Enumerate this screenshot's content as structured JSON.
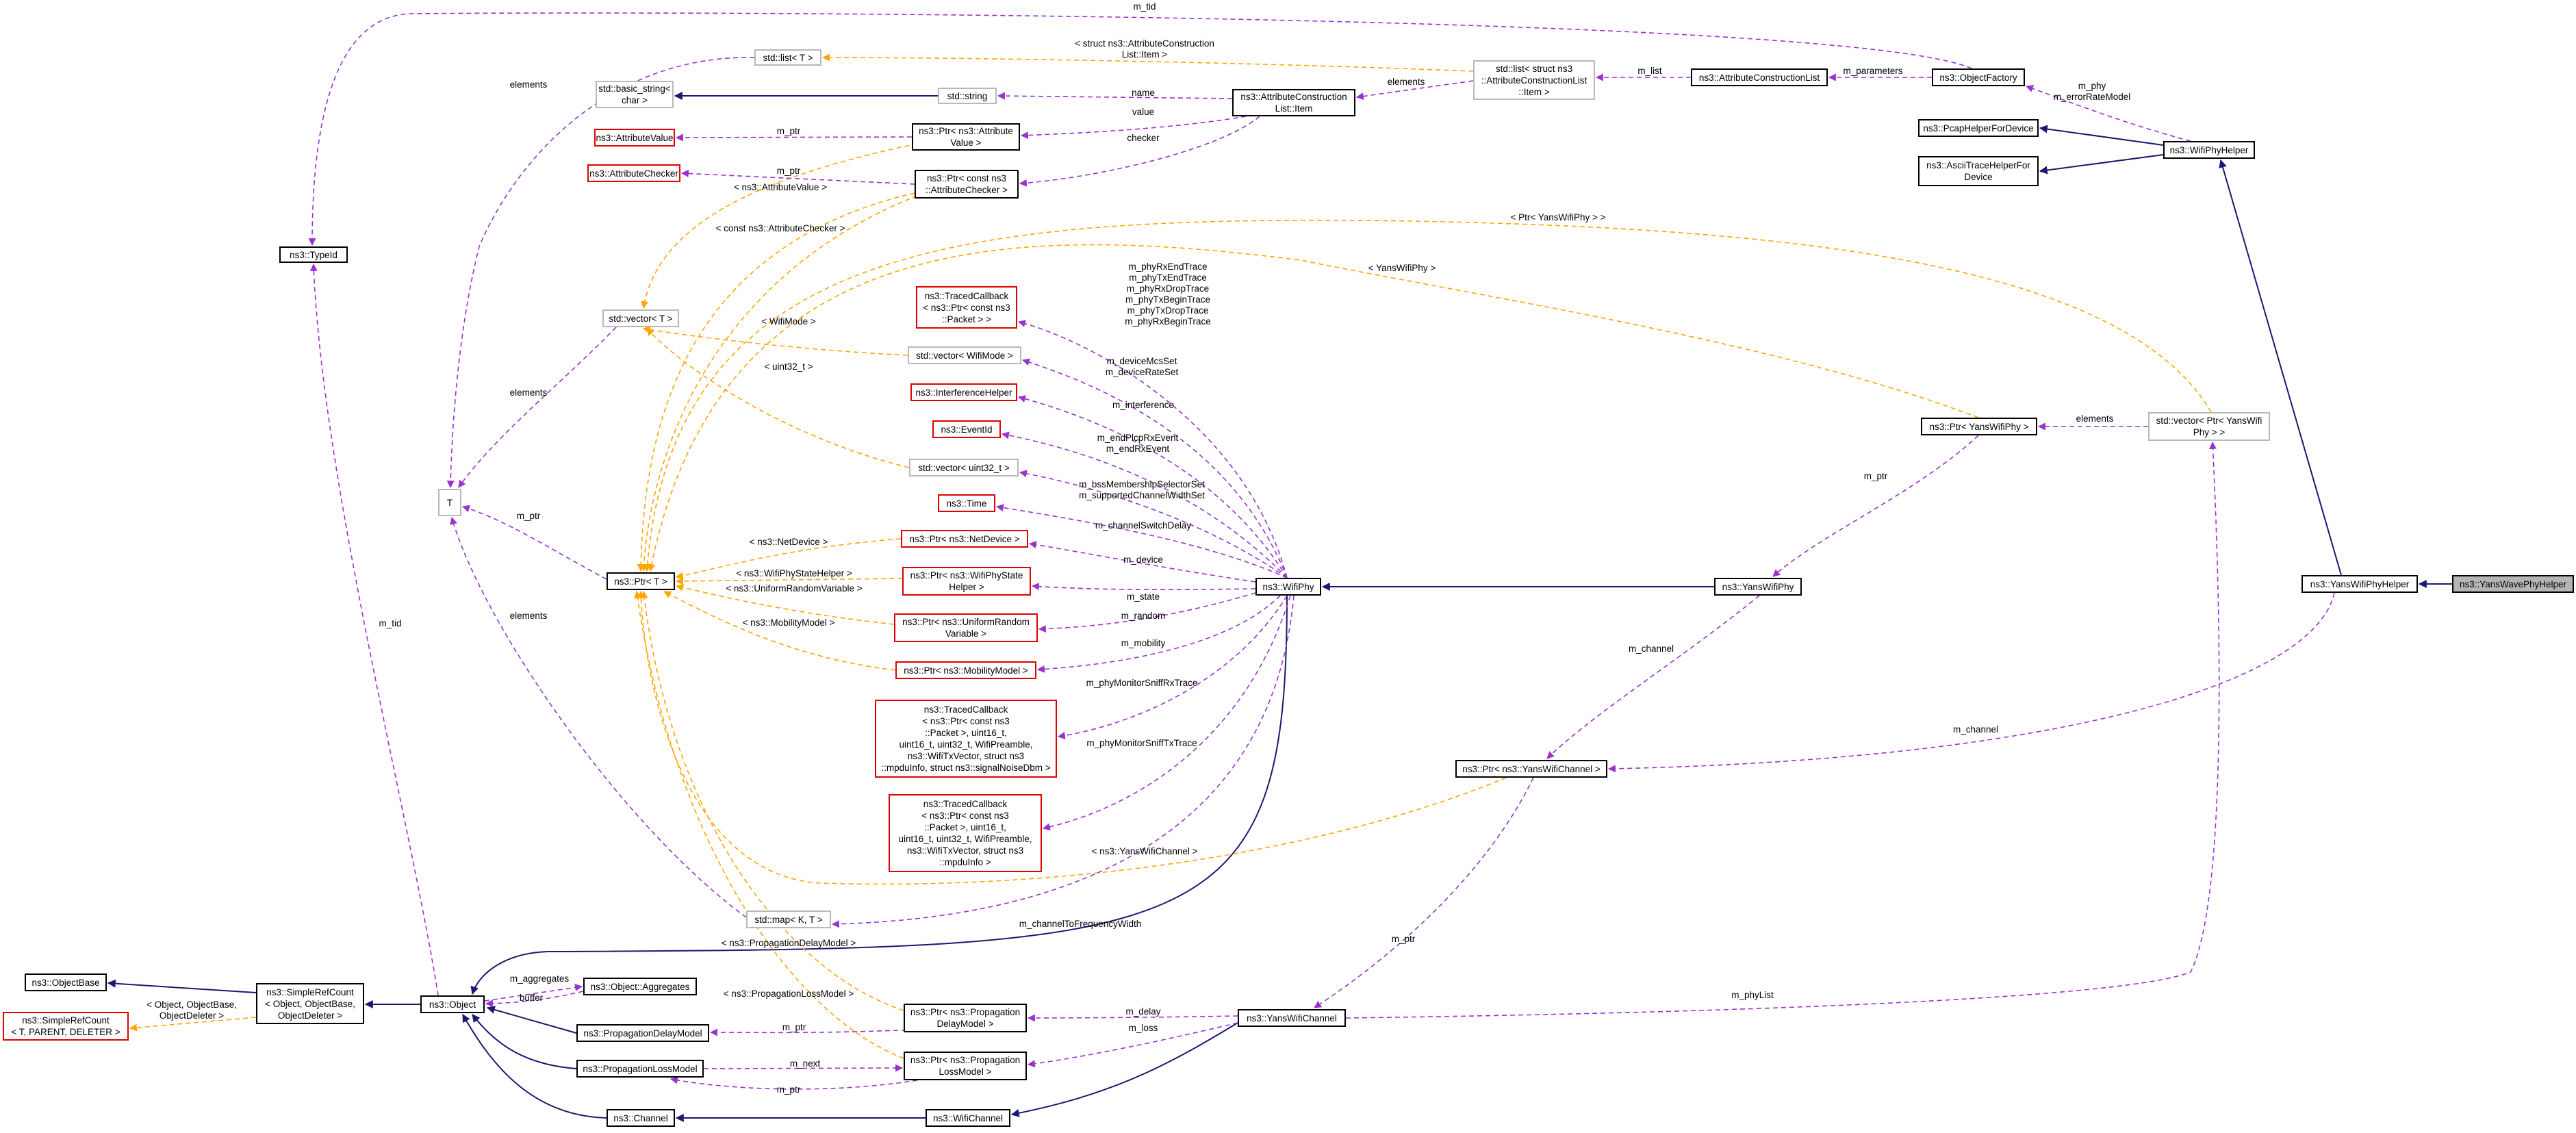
{
  "diagram": {
    "nodes": {
      "typeid": "ns3::TypeId",
      "list_t": "std::list< T >",
      "basic_string": "std::basic_string<\nchar >",
      "std_string": "std::string",
      "attribute_value": "ns3::AttributeValue",
      "attribute_checker": "ns3::AttributeChecker",
      "ptr_attr_value": "ns3::Ptr< ns3::Attribute\nValue >",
      "ptr_attr_checker": "ns3::Ptr< const ns3\n::AttributeChecker >",
      "attr_construction_item": "ns3::AttributeConstruction\nList::Item",
      "std_list_item": "std::list< struct ns3\n::AttributeConstructionList\n::Item >",
      "attr_construction_list": "ns3::AttributeConstructionList",
      "object_factory": "ns3::ObjectFactory",
      "pcap_helper": "ns3::PcapHelperForDevice",
      "ascii_helper": "ns3::AsciiTraceHelperFor\nDevice",
      "wifi_phy_helper": "ns3::WifiPhyHelper",
      "std_vector_t": "std::vector< T >",
      "traced_cb_packet": "ns3::TracedCallback\n< ns3::Ptr< const ns3\n::Packet > >",
      "vector_wifimode": "std::vector< WifiMode >",
      "interference_helper": "ns3::InterferenceHelper",
      "event_id": "ns3::EventId",
      "vector_uint32": "std::vector< uint32_t >",
      "time": "ns3::Time",
      "t": "T",
      "ptr_t": "ns3::Ptr< T >",
      "ptr_netdevice": "ns3::Ptr< ns3::NetDevice >",
      "ptr_wifiphy_state": "ns3::Ptr< ns3::WifiPhyState\nHelper >",
      "ptr_uniform_random": "ns3::Ptr< ns3::UniformRandom\nVariable >",
      "ptr_mobility": "ns3::Ptr< ns3::MobilityModel >",
      "traced_cb_monitor_rx": "ns3::TracedCallback\n< ns3::Ptr< const ns3\n::Packet >, uint16_t,\nuint16_t, uint32_t, WifiPreamble,\nns3::WifiTxVector, struct ns3\n::mpduInfo, struct ns3::signalNoiseDbm >",
      "traced_cb_monitor_tx": "ns3::TracedCallback\n< ns3::Ptr< const ns3\n::Packet >, uint16_t,\nuint16_t, uint32_t, WifiPreamble,\nns3::WifiTxVector, struct ns3\n::mpduInfo >",
      "wifi_phy": "ns3::WifiPhy",
      "ptr_yans_wifi_phy": "ns3::Ptr< YansWifiPhy >",
      "vector_ptr_yans": "std::vector< Ptr< YansWifi\nPhy > >",
      "yans_wifi_phy": "ns3::YansWifiPhy",
      "yans_wifi_phy_helper": "ns3::YansWifiPhyHelper",
      "yans_wave_phy_helper": "ns3::YansWavePhyHelper",
      "ptr_yans_wifi_channel": "ns3::Ptr< ns3::YansWifiChannel >",
      "std_map": "std::map< K, T >",
      "object_base": "ns3::ObjectBase",
      "simple_ref_count": "ns3::SimpleRefCount\n< Object, ObjectBase,\nObjectDeleter >",
      "simple_ref_count_t": "ns3::SimpleRefCount\n< T, PARENT, DELETER >",
      "object": "ns3::Object",
      "object_aggregates": "ns3::Object::Aggregates",
      "propagation_delay_model": "ns3::PropagationDelayModel",
      "propagation_loss_model": "ns3::PropagationLossModel",
      "ptr_prop_delay": "ns3::Ptr< ns3::Propagation\nDelayModel >",
      "ptr_prop_loss": "ns3::Ptr< ns3::Propagation\nLossModel >",
      "yans_wifi_channel": "ns3::YansWifiChannel",
      "wifi_channel": "ns3::WifiChannel",
      "channel": "ns3::Channel"
    },
    "edge_labels": {
      "m_tid_top": "m_tid",
      "m_tid_left": "m_tid",
      "elements_list": "elements",
      "elements_vector": "elements",
      "elements_map": "elements",
      "elements_std_list": "elements",
      "elements_yans": "elements",
      "tmpl_attr_item": "< struct ns3::AttributeConstruction\nList::Item >",
      "name": "name",
      "value": "value",
      "checker": "checker",
      "m_list": "m_list",
      "m_parameters": "m_parameters",
      "m_phy": "m_phy\nm_errorRateModel",
      "m_ptr_av": "m_ptr",
      "m_ptr_ac": "m_ptr",
      "m_ptr_t": "m_ptr",
      "m_ptr_yans": "m_ptr",
      "m_ptr_channel": "m_ptr",
      "m_ptr_delay": "m_ptr",
      "m_ptr_loss": "m_ptr",
      "tmpl_attr_value": "< ns3::AttributeValue >",
      "tmpl_attr_checker": "< const ns3::AttributeChecker >",
      "tmpl_ptr_yans_vec": "< Ptr< YansWifiPhy > >",
      "tmpl_yans_phy": "< YansWifiPhy >",
      "tmpl_wifimode": "< WifiMode >",
      "tmpl_uint32": "< uint32_t >",
      "tmpl_netdevice": "< ns3::NetDevice >",
      "tmpl_state_helper": "< ns3::WifiPhyStateHelper >",
      "tmpl_uniform_random": "< ns3::UniformRandomVariable >",
      "tmpl_mobility": "< ns3::MobilityModel >",
      "tmpl_yans_channel": "< ns3::YansWifiChannel >",
      "tmpl_prop_delay": "< ns3::PropagationDelayModel >",
      "tmpl_prop_loss": "< ns3::PropagationLossModel >",
      "tmpl_simple_ref": "< Object, ObjectBase,\nObjectDeleter >",
      "traces": "m_phyRxEndTrace\nm_phyTxEndTrace\nm_phyRxDropTrace\nm_phyTxBeginTrace\nm_phyTxDropTrace\nm_phyRxBeginTrace",
      "m_device_mcs": "m_deviceMcsSet\nm_deviceRateSet",
      "m_interference": "m_interference",
      "m_end_plcp": "m_endPlcpRxEvent\nm_endRxEvent",
      "m_bss": "m_bssMembershipSelectorSet\nm_supportedChannelWidthSet",
      "m_channel_switch": "m_channelSwitchDelay",
      "m_device": "m_device",
      "m_state": "m_state",
      "m_random": "m_random",
      "m_mobility": "m_mobility",
      "m_monitor_rx": "m_phyMonitorSniffRxTrace",
      "m_monitor_tx": "m_phyMonitorSniffTxTrace",
      "m_channel_freq": "m_channelToFrequencyWidth",
      "m_channel_yans": "m_channel",
      "m_channel_helper": "m_channel",
      "m_phy_list": "m_phyList",
      "m_aggregates": "m_aggregates",
      "buffer": "buffer",
      "m_next": "m_next",
      "m_delay": "m_delay",
      "m_loss": "m_loss"
    }
  }
}
